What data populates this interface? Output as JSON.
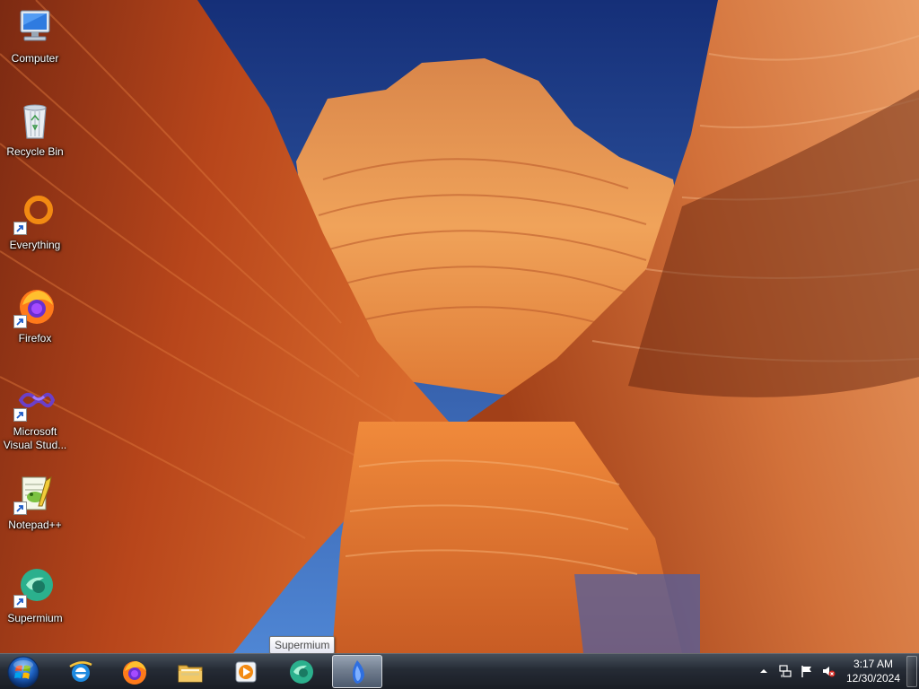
{
  "desktop": {
    "icons": [
      {
        "label": "Computer",
        "icon": "computer-icon",
        "shortcut": false
      },
      {
        "label": "Recycle Bin",
        "icon": "recycle-bin-icon",
        "shortcut": false
      },
      {
        "label": "Everything",
        "icon": "everything-search-icon",
        "shortcut": true
      },
      {
        "label": "Firefox",
        "icon": "firefox-icon",
        "shortcut": true
      },
      {
        "label": "Microsoft Visual Stud...",
        "icon": "visual-studio-icon",
        "shortcut": true
      },
      {
        "label": "Notepad++",
        "icon": "notepad-plus-plus-icon",
        "shortcut": true
      },
      {
        "label": "Supermium",
        "icon": "supermium-icon",
        "shortcut": true
      }
    ]
  },
  "tooltip": {
    "text": "Supermium"
  },
  "taskbar": {
    "start_icon": "windows-start-orb-icon",
    "pinned": [
      {
        "name": "internet-explorer",
        "icon": "internet-explorer-icon"
      },
      {
        "name": "firefox",
        "icon": "firefox-icon"
      },
      {
        "name": "file-explorer",
        "icon": "folder-icon"
      },
      {
        "name": "media-player",
        "icon": "media-player-icon"
      },
      {
        "name": "supermium",
        "icon": "supermium-icon"
      },
      {
        "name": "active-app",
        "icon": "blue-flame-icon",
        "active": true
      }
    ],
    "tray": {
      "icons": [
        "show-hidden-icons-icon",
        "network-icon",
        "action-center-flag-icon",
        "volume-muted-icon"
      ],
      "time": "3:17 AM",
      "date": "12/30/2024"
    }
  },
  "colors": {
    "accent": "#1c5fbf",
    "taskbar": "#1c222c"
  }
}
